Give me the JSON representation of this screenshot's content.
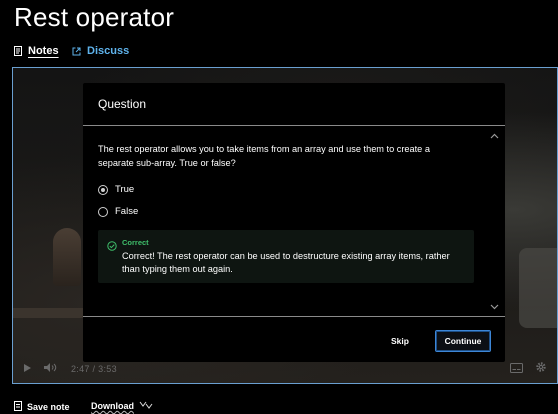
{
  "page": {
    "title": "Rest operator"
  },
  "tabs": [
    {
      "label": "Notes",
      "icon": "notes-icon",
      "active": true
    },
    {
      "label": "Discuss",
      "icon": "external-link-icon",
      "active": false
    }
  ],
  "video": {
    "current_time": "2:47",
    "separator": "/",
    "duration": "3:53"
  },
  "dialog": {
    "title": "Question",
    "question": "The rest operator allows you to take items from an array and use them to create a separate sub-array. True or false?",
    "options": [
      {
        "label": "True",
        "selected": true
      },
      {
        "label": "False",
        "selected": false
      }
    ],
    "feedback": {
      "status": "Correct",
      "message": "Correct! The rest operator can be used to destructure existing array items, rather than typing them out again.",
      "color": "#3fbf6b"
    },
    "skip_label": "Skip",
    "continue_label": "Continue"
  },
  "bottom": {
    "save_note_label": "Save note",
    "download_label": "Download"
  },
  "colors": {
    "accent": "#3d86d6",
    "link": "#5fb3ec",
    "background": "#000000"
  }
}
